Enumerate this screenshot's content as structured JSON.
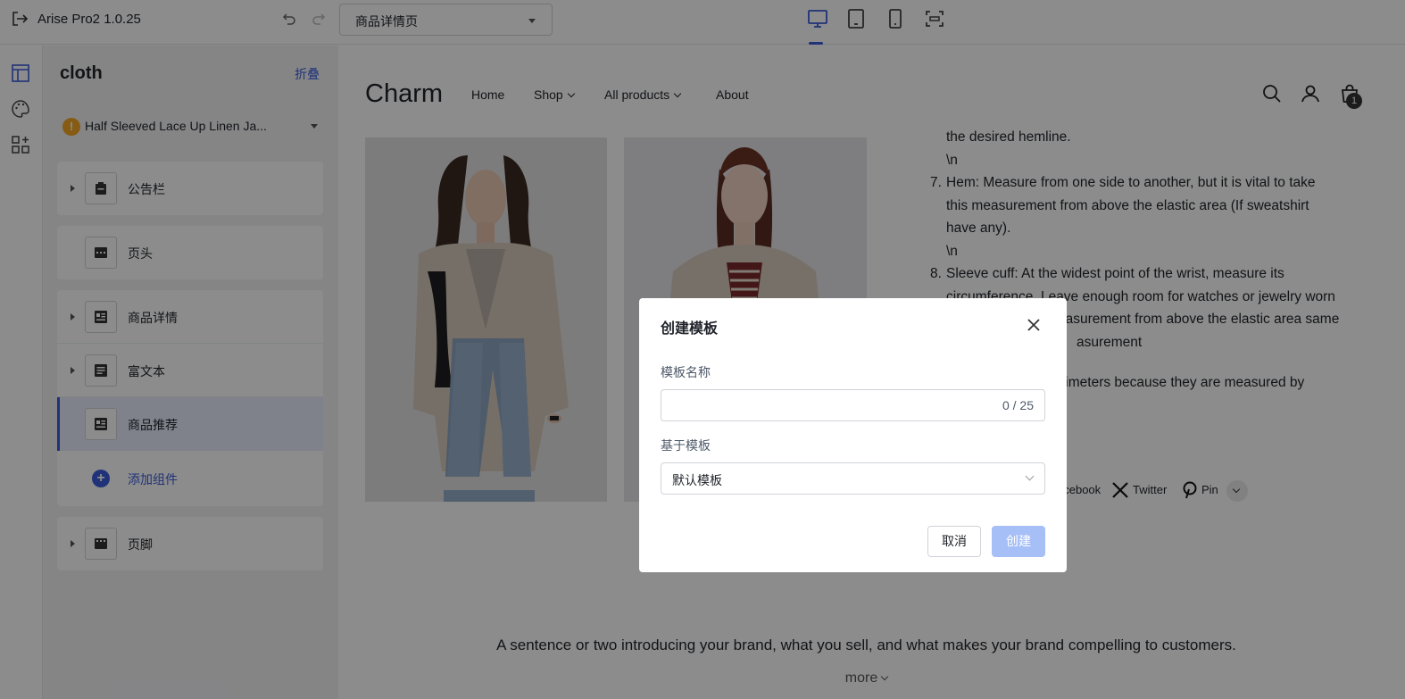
{
  "topbar": {
    "app_name": "Arise Pro2  1.0.25",
    "page_select_value": "商品详情页",
    "devices": [
      "desktop-icon",
      "tablet-icon",
      "mobile-icon",
      "fullscreen-icon"
    ]
  },
  "rail": {
    "icons": [
      "layout-icon",
      "palette-icon",
      "apps-icon"
    ]
  },
  "panel": {
    "title": "cloth",
    "collapse_label": "折叠",
    "product": {
      "warning": "!",
      "name": "Half Sleeved Lace Up Linen Ja..."
    },
    "sections": {
      "announcement": "公告栏",
      "header": "页头",
      "product_detail": "商品详情",
      "rich_text": "富文本",
      "recommend": "商品推荐",
      "add_component": "添加组件",
      "footer": "页脚"
    }
  },
  "store": {
    "logo": "Charm",
    "nav": {
      "home": "Home",
      "shop": "Shop",
      "all_products": "All products",
      "about": "About"
    },
    "cart_count": "1",
    "desc": {
      "l1": "the desired hemline.",
      "l2": "\\n",
      "n7": "7.",
      "l3": "Hem: Measure from one side to another, but it is vital to take",
      "l4": "this measurement from above the elastic area (If sweatshirt",
      "l5": "have any).",
      "l6": "\\n",
      "n8": "8.",
      "l7": "Sleeve cuff: At the widest point of the wrist, measure its",
      "l8": "circumference. Leave enough room for watches or jewelry worn",
      "l9": "easurement from above the elastic area same",
      "l10": "asurement",
      "l11": "centimeters because they are measured by"
    },
    "social": {
      "facebook": "acebook",
      "twitter": "Twitter",
      "pinterest": "Pin"
    },
    "brand_text": "A sentence or two introducing your brand, what you sell, and what makes your brand compelling to customers.",
    "more": "more"
  },
  "modal": {
    "title": "创建模板",
    "name_label": "模板名称",
    "name_value": "",
    "name_counter": "0 / 25",
    "base_label": "基于模板",
    "base_value": "默认模板",
    "cancel": "取消",
    "create": "创建"
  }
}
